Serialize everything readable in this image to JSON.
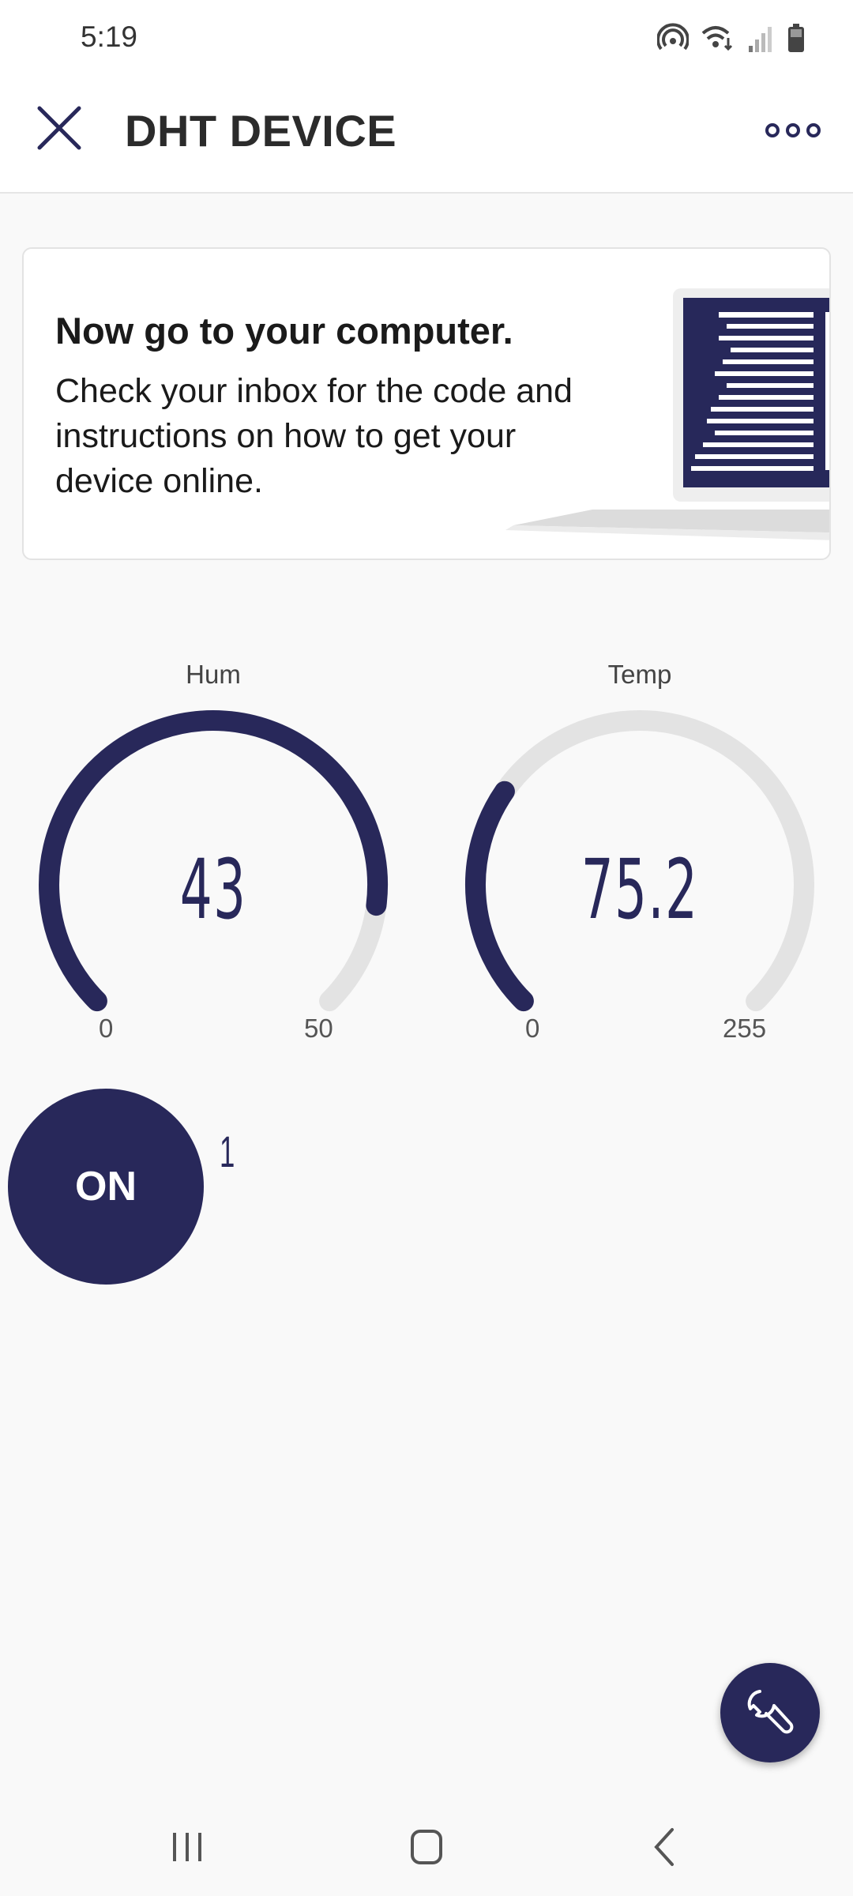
{
  "status_bar": {
    "time": "5:19",
    "icons": [
      "hotspot-icon",
      "wifi-icon",
      "signal-icon",
      "battery-icon"
    ]
  },
  "header": {
    "title": "DHT DEVICE",
    "close_icon": "close-icon",
    "menu_icon": "more-options-icon"
  },
  "banner": {
    "title": "Now go to your computer.",
    "body": "Check your inbox for the code and instructions on how to get your device online.",
    "image": "laptop-illustration"
  },
  "gauges": [
    {
      "label": "Hum",
      "value": "43",
      "min": "0",
      "max": "50",
      "fraction": 0.86
    },
    {
      "label": "Temp",
      "value": "75.2",
      "min": "0",
      "max": "255",
      "fraction": 0.295
    }
  ],
  "switch": {
    "label": "ON",
    "value": "1"
  },
  "fab": {
    "icon": "wrench-icon"
  },
  "colors": {
    "accent": "#28285a",
    "track": "#e3e3e3",
    "background": "#f9f9f9"
  },
  "nav": {
    "icons": [
      "recent-apps-icon",
      "home-icon",
      "back-icon"
    ]
  }
}
